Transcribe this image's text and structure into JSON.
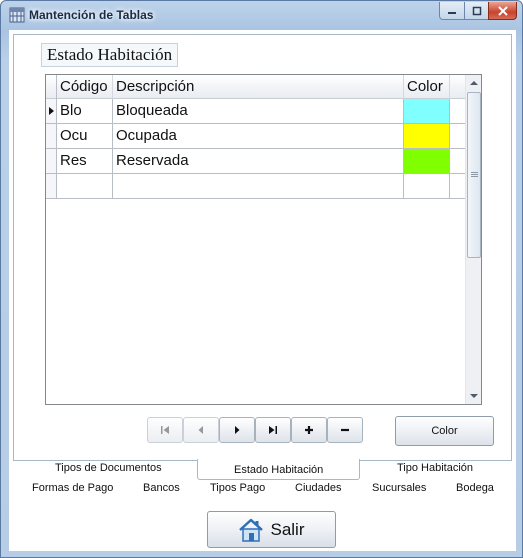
{
  "window": {
    "title": "Mantención de Tablas"
  },
  "tabpage": {
    "group_title": "Estado Habitación"
  },
  "grid": {
    "columns": [
      "Código",
      "Descripción",
      "Color"
    ],
    "rows": [
      {
        "code": "Blo",
        "description": "Bloqueada",
        "color": "#80ffff",
        "current": true
      },
      {
        "code": "Ocu",
        "description": "Ocupada",
        "color": "#ffff00",
        "current": false
      },
      {
        "code": "Res",
        "description": "Reservada",
        "color": "#80ff00",
        "current": false
      },
      {
        "code": "",
        "description": "",
        "color": "",
        "current": false
      }
    ]
  },
  "navigator": {
    "buttons": [
      "first-icon",
      "previous-icon",
      "next-icon",
      "last-icon",
      "add-icon",
      "delete-icon"
    ]
  },
  "color_button": {
    "label": "Color"
  },
  "tabs": {
    "row1": [
      "Tipos de Documentos",
      "Estado Habitación",
      "Tipo Habitación"
    ],
    "row2": [
      "Formas de Pago",
      "Bancos",
      "Tipos Pago",
      "Ciudades",
      "Sucursales",
      "Bodega"
    ],
    "active": "Estado Habitación"
  },
  "exit_button": {
    "label": "Salir",
    "icon": "home-icon"
  }
}
